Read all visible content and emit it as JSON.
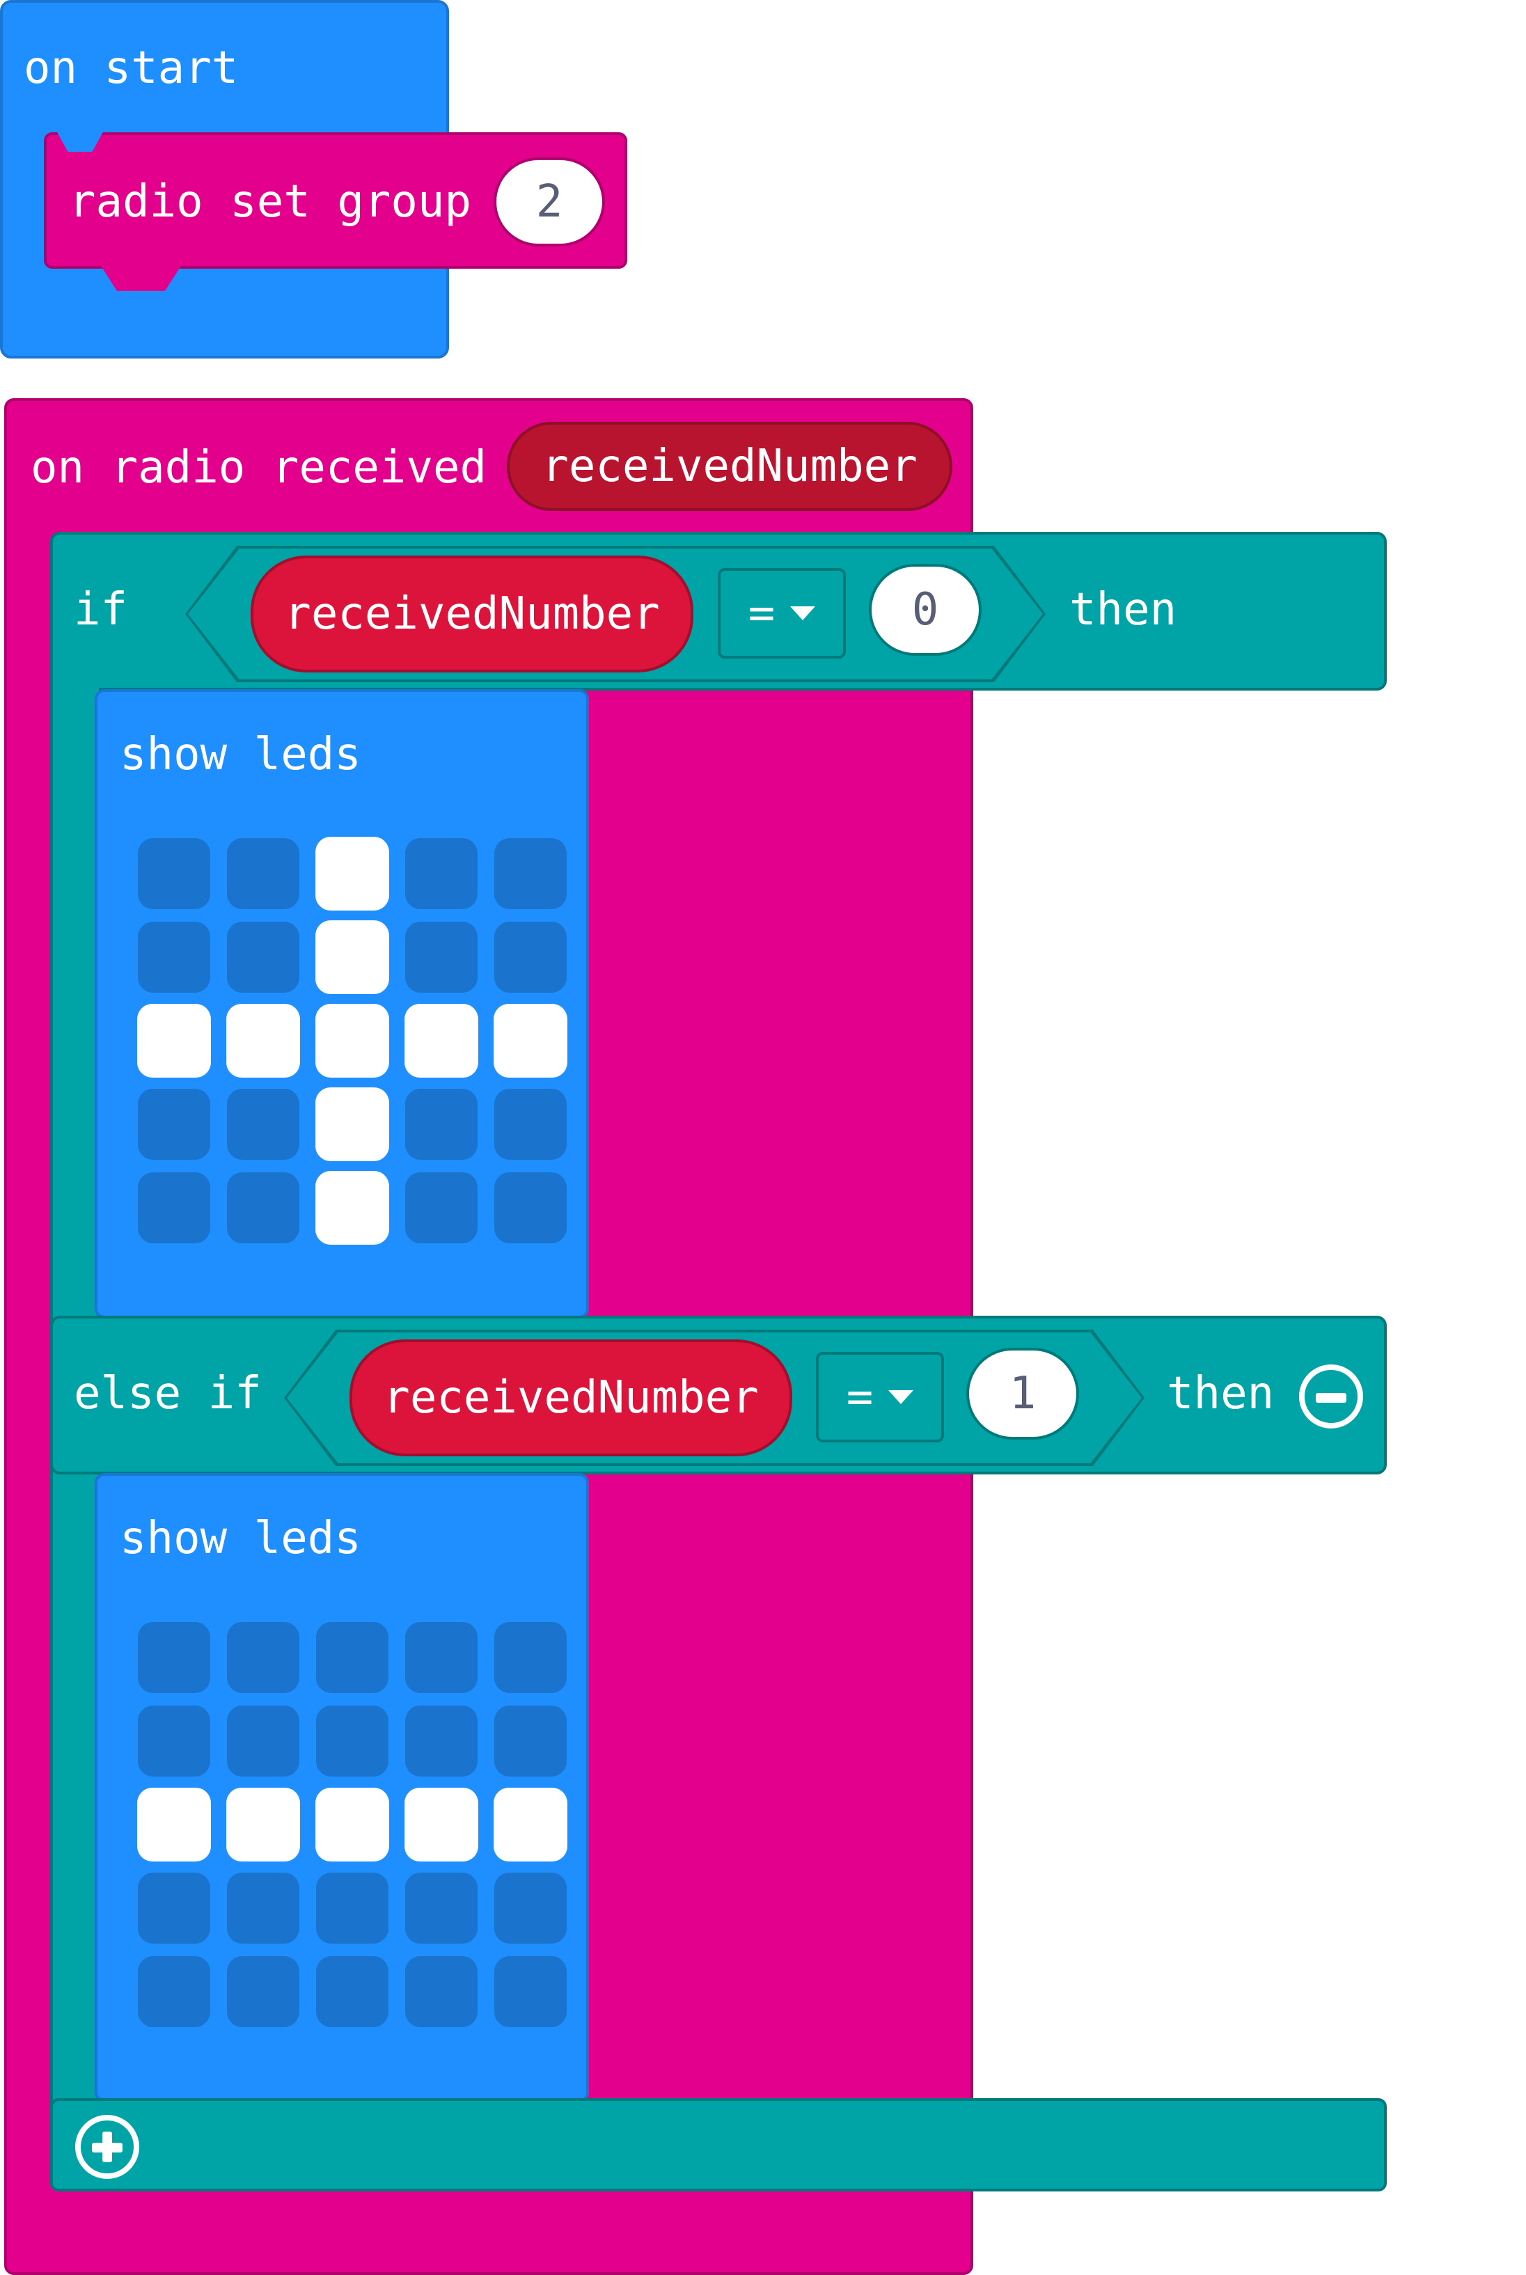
{
  "on_start": {
    "label": "on start",
    "radio_set_group": {
      "label": "radio set group",
      "value": "2"
    }
  },
  "on_radio_received": {
    "label": "on radio received",
    "param": "receivedNumber",
    "if_block": {
      "if_label": "if",
      "condition": {
        "variable": "receivedNumber",
        "operator": "=",
        "value": "0"
      },
      "then_label": "then",
      "show_leds": {
        "label": "show leds",
        "grid": [
          [
            0,
            0,
            1,
            0,
            0
          ],
          [
            0,
            0,
            1,
            0,
            0
          ],
          [
            1,
            1,
            1,
            1,
            1
          ],
          [
            0,
            0,
            1,
            0,
            0
          ],
          [
            0,
            0,
            1,
            0,
            0
          ]
        ]
      }
    },
    "else_if_block": {
      "label": "else if",
      "condition": {
        "variable": "receivedNumber",
        "operator": "=",
        "value": "1"
      },
      "then_label": "then",
      "remove_icon": "minus-circle-icon",
      "show_leds": {
        "label": "show leds",
        "grid": [
          [
            0,
            0,
            0,
            0,
            0
          ],
          [
            0,
            0,
            0,
            0,
            0
          ],
          [
            1,
            1,
            1,
            1,
            1
          ],
          [
            0,
            0,
            0,
            0,
            0
          ],
          [
            0,
            0,
            0,
            0,
            0
          ]
        ]
      }
    },
    "add_icon": "plus-circle-icon"
  },
  "colors": {
    "basic_blue": "#1f8fff",
    "radio_pink": "#e3008c",
    "logic_teal": "#00a4a6",
    "variable_red": "#dc143c",
    "param_dark_red": "#b8142f",
    "led_off": "#1a73cc",
    "led_on": "#ffffff"
  }
}
